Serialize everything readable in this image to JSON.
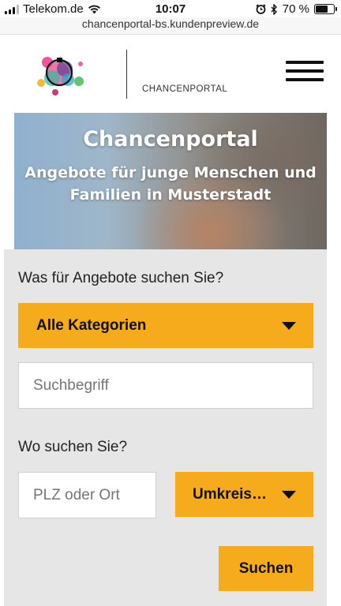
{
  "status_bar": {
    "carrier": "Telekom.de",
    "time": "10:07",
    "battery_percent": "70 %",
    "battery_level": 0.7
  },
  "browser": {
    "url": "chancenportal-bs.kundenpreview.de"
  },
  "header": {
    "brand_label": "CHANCENPORTAL"
  },
  "hero": {
    "title": "Chancenportal",
    "subtitle": "Angebote für junge Menschen und Familien in Musterstadt"
  },
  "search": {
    "what_label": "Was für Angebote suchen Sie?",
    "category_select": "Alle Kategorien",
    "keyword_placeholder": "Suchbegriff",
    "where_label": "Wo suchen Sie?",
    "location_placeholder": "PLZ oder Ort",
    "radius_select": "Umkreis…",
    "submit_label": "Suchen"
  },
  "colors": {
    "accent": "#f5ab1b",
    "panel": "#e6e6e6"
  },
  "icons": [
    "signal-icon",
    "wifi-icon",
    "alarm-icon",
    "bluetooth-icon",
    "battery-icon",
    "hamburger-menu-icon",
    "chevron-down-icon"
  ]
}
